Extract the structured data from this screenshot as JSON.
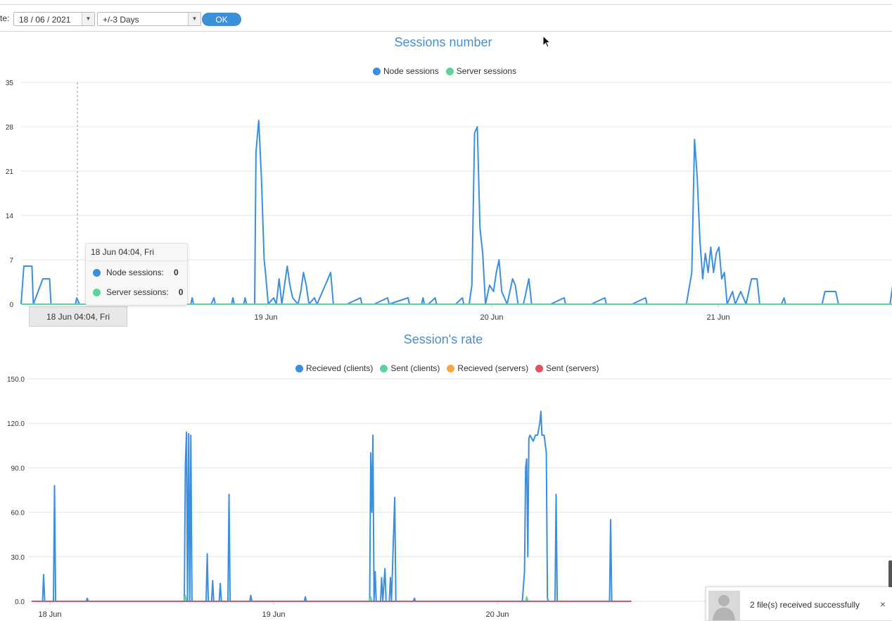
{
  "toolbar": {
    "date_label": "te:",
    "date_value": "18 / 06 / 2021",
    "range_value": "+/-3 Days",
    "ok_label": "OK"
  },
  "colors": {
    "node": "#3a8fe0",
    "server": "#5fd39c",
    "recv_clients": "#3a8fe0",
    "sent_clients": "#5fd39c",
    "recv_servers": "#f5a742",
    "sent_servers": "#e5505a",
    "title": "#4a90c8"
  },
  "chart_data": [
    {
      "type": "line",
      "title": "Sessions number",
      "legend": [
        "Node sessions",
        "Server sessions"
      ],
      "legend_position": "top-center",
      "grid": true,
      "ylim": [
        0,
        35
      ],
      "y_ticks": [
        "35",
        "28",
        "21",
        "14",
        "7",
        "0"
      ],
      "x_ticks": [
        "19 Jun",
        "20 Jun",
        "21 Jun"
      ],
      "series": [
        {
          "name": "Node sessions",
          "points": [
            [
              0,
              0
            ],
            [
              0.02,
              6
            ],
            [
              0.08,
              6
            ],
            [
              0.09,
              0
            ],
            [
              0.16,
              4
            ],
            [
              0.21,
              4
            ],
            [
              0.22,
              0
            ],
            [
              0.4,
              0
            ],
            [
              0.41,
              1
            ],
            [
              0.43,
              0
            ],
            [
              0.6,
              0
            ],
            [
              0.62,
              5
            ],
            [
              0.68,
              4
            ],
            [
              0.69,
              0
            ],
            [
              0.8,
              0
            ],
            [
              0.82,
              1
            ],
            [
              0.83,
              0
            ],
            [
              1.0,
              0
            ],
            [
              1.05,
              1
            ],
            [
              1.06,
              0
            ],
            [
              1.25,
              0
            ],
            [
              1.26,
              1
            ],
            [
              1.27,
              0
            ],
            [
              1.4,
              0
            ],
            [
              1.42,
              1
            ],
            [
              1.43,
              0
            ],
            [
              1.55,
              0
            ],
            [
              1.56,
              1
            ],
            [
              1.57,
              0
            ],
            [
              1.64,
              0
            ],
            [
              1.65,
              1
            ],
            [
              1.66,
              0
            ],
            [
              1.72,
              0
            ],
            [
              1.73,
              24
            ],
            [
              1.75,
              29
            ],
            [
              1.77,
              20
            ],
            [
              1.79,
              7
            ],
            [
              1.8,
              5
            ],
            [
              1.82,
              0
            ],
            [
              1.86,
              1
            ],
            [
              1.88,
              0
            ],
            [
              1.9,
              4
            ],
            [
              1.92,
              0
            ],
            [
              1.96,
              6
            ],
            [
              1.98,
              3
            ],
            [
              2.0,
              1
            ],
            [
              2.04,
              0
            ],
            [
              2.06,
              2
            ],
            [
              2.08,
              5
            ],
            [
              2.1,
              3
            ],
            [
              2.12,
              0
            ],
            [
              2.16,
              1
            ],
            [
              2.18,
              0
            ],
            [
              2.26,
              4
            ],
            [
              2.28,
              5
            ],
            [
              2.3,
              0
            ],
            [
              2.4,
              0
            ],
            [
              2.5,
              1
            ],
            [
              2.51,
              0
            ],
            [
              2.6,
              0
            ],
            [
              2.7,
              1
            ],
            [
              2.71,
              0
            ],
            [
              2.85,
              1
            ],
            [
              2.86,
              0
            ],
            [
              2.95,
              0
            ],
            [
              2.96,
              1
            ],
            [
              2.97,
              0
            ],
            [
              3.0,
              0
            ],
            [
              3.05,
              1
            ],
            [
              3.06,
              0
            ],
            [
              3.2,
              0
            ],
            [
              3.25,
              1
            ],
            [
              3.26,
              0
            ],
            [
              3.3,
              0
            ],
            [
              3.32,
              3
            ],
            [
              3.34,
              27
            ],
            [
              3.36,
              28
            ],
            [
              3.38,
              12
            ],
            [
              3.4,
              8
            ],
            [
              3.42,
              0
            ],
            [
              3.45,
              3
            ],
            [
              3.48,
              2
            ],
            [
              3.5,
              5
            ],
            [
              3.52,
              7
            ],
            [
              3.54,
              2
            ],
            [
              3.58,
              0
            ],
            [
              3.62,
              4
            ],
            [
              3.64,
              3
            ],
            [
              3.66,
              0
            ],
            [
              3.7,
              0
            ],
            [
              3.74,
              4
            ],
            [
              3.76,
              0
            ],
            [
              3.9,
              0
            ],
            [
              4.0,
              1
            ],
            [
              4.01,
              0
            ],
            [
              4.2,
              0
            ],
            [
              4.3,
              1
            ],
            [
              4.31,
              0
            ],
            [
              4.5,
              0
            ],
            [
              4.6,
              1
            ],
            [
              4.61,
              0
            ],
            [
              4.9,
              0
            ],
            [
              4.94,
              5
            ],
            [
              4.96,
              26
            ],
            [
              4.98,
              20
            ],
            [
              5.0,
              10
            ],
            [
              5.02,
              4
            ],
            [
              5.04,
              8
            ],
            [
              5.06,
              5
            ],
            [
              5.08,
              9
            ],
            [
              5.1,
              5
            ],
            [
              5.12,
              8
            ],
            [
              5.14,
              9
            ],
            [
              5.16,
              4
            ],
            [
              5.18,
              5
            ],
            [
              5.2,
              0
            ],
            [
              5.24,
              2
            ],
            [
              5.26,
              0
            ],
            [
              5.3,
              2
            ],
            [
              5.32,
              1
            ],
            [
              5.34,
              0
            ],
            [
              5.38,
              4
            ],
            [
              5.42,
              4
            ],
            [
              5.44,
              0
            ],
            [
              5.6,
              0
            ],
            [
              5.62,
              1
            ],
            [
              5.63,
              0
            ],
            [
              5.9,
              0
            ],
            [
              5.92,
              2
            ],
            [
              6.0,
              2
            ],
            [
              6.02,
              0
            ],
            [
              6.2,
              0
            ],
            [
              6.4,
              0
            ],
            [
              6.42,
              3
            ]
          ]
        },
        {
          "name": "Server sessions",
          "points": [
            [
              0,
              0
            ],
            [
              6.42,
              0
            ]
          ]
        }
      ]
    },
    {
      "type": "line",
      "title": "Session's rate",
      "legend": [
        "Recieved (clients)",
        "Sent (clients)",
        "Recieved (servers)",
        "Sent (servers)"
      ],
      "legend_position": "top-center",
      "grid": true,
      "ylim": [
        0,
        150
      ],
      "y_ticks": [
        "150.0",
        "120.0",
        "90.0",
        "60.0",
        "30.0",
        "0.0"
      ],
      "x_ticks": [
        "18 Jun",
        "19 Jun",
        "20 Jun"
      ],
      "series": [
        {
          "name": "Recieved (clients)",
          "points": [
            [
              0,
              0
            ],
            [
              0.1,
              0
            ],
            [
              0.11,
              18
            ],
            [
              0.12,
              0
            ],
            [
              0.2,
              0
            ],
            [
              0.21,
              78
            ],
            [
              0.22,
              0
            ],
            [
              0.5,
              0
            ],
            [
              0.51,
              2
            ],
            [
              0.52,
              0
            ],
            [
              1.2,
              0
            ],
            [
              1.4,
              0
            ],
            [
              1.41,
              92
            ],
            [
              1.42,
              114
            ],
            [
              1.43,
              0
            ],
            [
              1.44,
              113
            ],
            [
              1.45,
              0
            ],
            [
              1.46,
              112
            ],
            [
              1.47,
              0
            ],
            [
              1.6,
              0
            ],
            [
              1.61,
              32
            ],
            [
              1.62,
              0
            ],
            [
              1.65,
              0
            ],
            [
              1.66,
              14
            ],
            [
              1.67,
              0
            ],
            [
              1.72,
              0
            ],
            [
              1.73,
              12
            ],
            [
              1.74,
              0
            ],
            [
              1.8,
              0
            ],
            [
              1.81,
              72
            ],
            [
              1.82,
              0
            ],
            [
              2.0,
              0
            ],
            [
              2.01,
              4
            ],
            [
              2.02,
              0
            ],
            [
              2.5,
              0
            ],
            [
              2.51,
              3
            ],
            [
              2.52,
              0
            ],
            [
              3.0,
              0
            ],
            [
              3.1,
              0
            ],
            [
              3.11,
              100
            ],
            [
              3.12,
              60
            ],
            [
              3.13,
              112
            ],
            [
              3.14,
              0
            ],
            [
              3.15,
              20
            ],
            [
              3.16,
              0
            ],
            [
              3.2,
              0
            ],
            [
              3.21,
              16
            ],
            [
              3.22,
              0
            ],
            [
              3.24,
              22
            ],
            [
              3.25,
              0
            ],
            [
              3.28,
              0
            ],
            [
              3.29,
              16
            ],
            [
              3.3,
              0
            ],
            [
              3.33,
              70
            ],
            [
              3.34,
              0
            ],
            [
              3.5,
              0
            ],
            [
              3.51,
              2
            ],
            [
              3.52,
              0
            ],
            [
              4.5,
              0
            ],
            [
              4.52,
              20
            ],
            [
              4.53,
              90
            ],
            [
              4.54,
              96
            ],
            [
              4.55,
              30
            ],
            [
              4.56,
              110
            ],
            [
              4.57,
              112
            ],
            [
              4.6,
              108
            ],
            [
              4.62,
              112
            ],
            [
              4.64,
              112
            ],
            [
              4.66,
              120
            ],
            [
              4.67,
              128
            ],
            [
              4.68,
              112
            ],
            [
              4.7,
              112
            ],
            [
              4.72,
              100
            ],
            [
              4.73,
              2
            ],
            [
              4.74,
              0
            ],
            [
              4.8,
              0
            ],
            [
              4.81,
              72
            ],
            [
              4.82,
              0
            ],
            [
              5.3,
              0
            ],
            [
              5.31,
              55
            ],
            [
              5.32,
              0
            ],
            [
              5.5,
              0
            ]
          ]
        },
        {
          "name": "Sent (clients)",
          "points": [
            [
              0,
              0
            ],
            [
              1.4,
              0
            ],
            [
              1.41,
              4
            ],
            [
              1.42,
              0
            ],
            [
              3.1,
              0
            ],
            [
              3.11,
              3
            ],
            [
              3.12,
              0
            ],
            [
              4.53,
              0
            ],
            [
              4.54,
              3
            ],
            [
              4.55,
              0
            ],
            [
              5.5,
              0
            ]
          ]
        },
        {
          "name": "Recieved (servers)",
          "points": [
            [
              0,
              0
            ],
            [
              5.5,
              0
            ]
          ]
        },
        {
          "name": "Sent (servers)",
          "points": [
            [
              0,
              0
            ],
            [
              5.5,
              0
            ]
          ]
        }
      ]
    }
  ],
  "tooltip": {
    "header": "18 Jun 04:04, Fri",
    "rows": [
      {
        "label": "Node sessions:",
        "value": "0"
      },
      {
        "label": "Server sessions:",
        "value": "0"
      }
    ]
  },
  "crosshair_label": "18 Jun 04:04, Fri",
  "notification": {
    "text": "2 file(s) received successfully",
    "close": "×"
  }
}
